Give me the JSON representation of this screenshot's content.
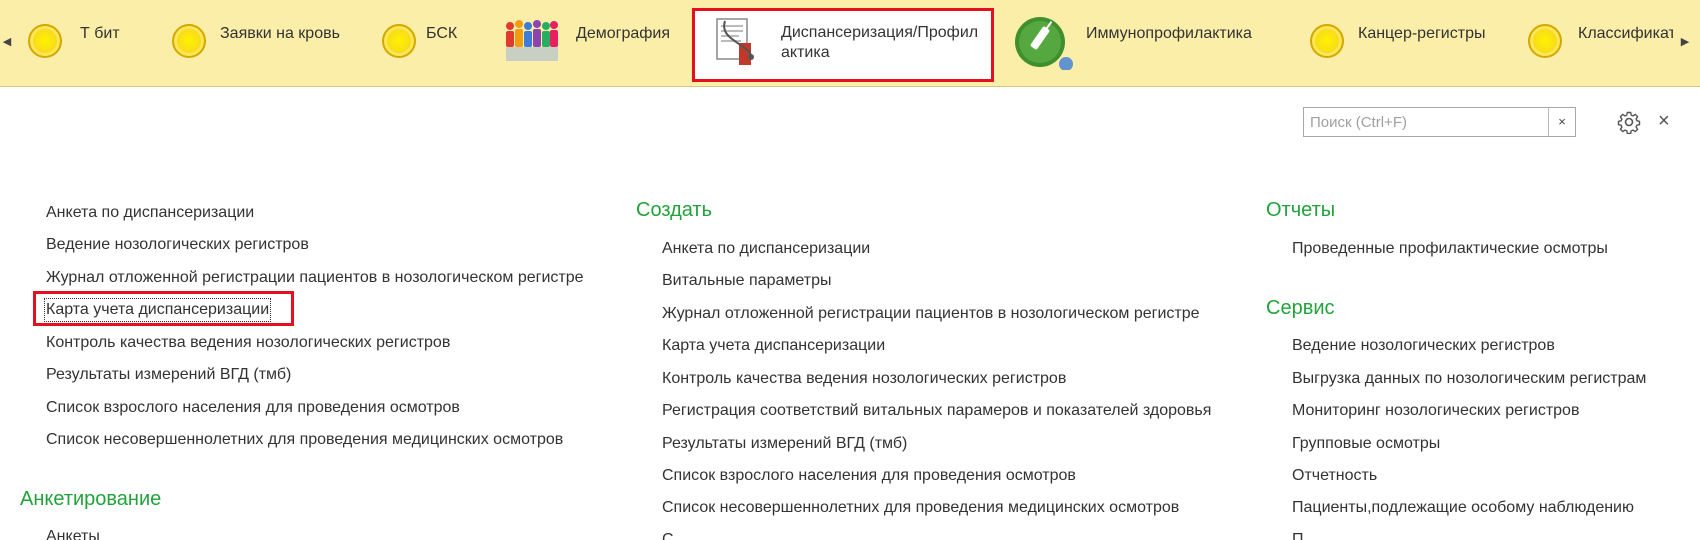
{
  "toolbar": {
    "scroll_left": "◀",
    "scroll_right": "▶",
    "tabs": [
      {
        "label": "Т бит",
        "icon": "circle-icon"
      },
      {
        "label": "Заявки на кровь",
        "icon": "circle-icon"
      },
      {
        "label": "БСК",
        "icon": "circle-icon"
      },
      {
        "label": "Демография",
        "icon": "people-icon"
      },
      {
        "label": "Диспансеризация/Профил\nактика",
        "icon": "medical-record-icon",
        "active": true
      },
      {
        "label": "Иммунопрофилактика",
        "icon": "syringe-icon"
      },
      {
        "label": "Канцер-регистры",
        "icon": "circle-icon"
      },
      {
        "label": "Классификат",
        "icon": "circle-icon"
      }
    ]
  },
  "search": {
    "placeholder": "Поиск (Ctrl+F)",
    "clear": "×"
  },
  "window": {
    "close": "×"
  },
  "columns": {
    "left": {
      "links": [
        "Анкета по диспансеризации",
        "Ведение нозологических регистров",
        "Журнал отложенной регистрации пациентов в нозологическом регистре",
        "Карта учета диспансеризации",
        "Контроль качества ведения нозологических регистров",
        "Результаты измерений ВГД (тмб)",
        "Список взрослого населения для проведения осмотров",
        "Список несовершеннолетних для проведения медицинских осмотров"
      ],
      "section2_title": "Анкетирование",
      "section2_links": [
        "Анкеты"
      ]
    },
    "middle": {
      "title": "Создать",
      "links": [
        "Анкета по диспансеризации",
        "Витальные параметры",
        "Журнал отложенной регистрации пациентов в нозологическом регистре",
        "Карта учета диспансеризации",
        "Контроль качества ведения нозологических регистров",
        "Регистрация соответствий витальных парамеров и показателей здоровья",
        "Результаты измерений ВГД (тмб)",
        "Список взрослого населения для проведения осмотров",
        "Список несовершеннолетних для проведения медицинских осмотров",
        "С"
      ]
    },
    "right": {
      "reports_title": "Отчеты",
      "reports_links": [
        "Проведенные профилактические осмотры"
      ],
      "service_title": "Сервис",
      "service_links": [
        "Ведение нозологических регистров",
        "Выгрузка данных по нозологическим регистрам",
        "Мониторинг нозологических регистров",
        "Групповые осмотры",
        "Отчетность",
        "Пациенты,подлежащие особому наблюдению",
        "П"
      ]
    }
  },
  "colors": {
    "topbar_bg": "#fbeea9",
    "section_title": "#21a33b",
    "highlight": "#e3101e"
  }
}
